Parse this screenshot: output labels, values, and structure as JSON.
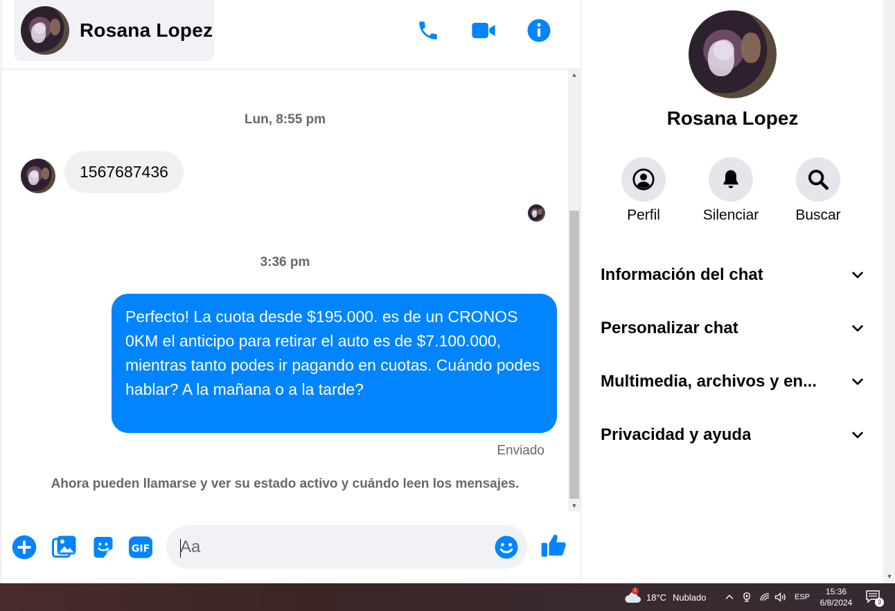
{
  "colors": {
    "accent": "#0084ff",
    "bubble_in": "#f0f0f0",
    "muted_text": "#65676b"
  },
  "header": {
    "contact_name": "Rosana Lopez",
    "actions": [
      {
        "icon": "phone-icon"
      },
      {
        "icon": "video-camera-icon"
      },
      {
        "icon": "info-icon"
      }
    ]
  },
  "messages": {
    "timestamp_1": "Lun, 8:55 pm",
    "received_text": "1567687436",
    "timestamp_2": "3:36 pm",
    "sent_text": "Perfecto! La cuota desde $195.000. es de un CRONOS 0KM el anticipo para retirar el auto es de $7.100.000, mientras tanto podes ir pagando en cuotas. Cuándo podes hablar? A la mañana o a la tarde?",
    "sent_status": "Enviado",
    "notice": "Ahora pueden llamarse y ver su estado activo y cuándo leen los mensajes."
  },
  "composer": {
    "placeholder": "Aa",
    "value": "",
    "icons": [
      "plus-icon",
      "image-icon",
      "sticker-icon",
      "gif-icon",
      "emoji-icon",
      "thumbs-up-icon"
    ],
    "gif_label": "GIF"
  },
  "info_panel": {
    "name": "Rosana Lopez",
    "actions": [
      {
        "label": "Perfil",
        "icon": "profile-icon"
      },
      {
        "label": "Silenciar",
        "icon": "bell-icon"
      },
      {
        "label": "Buscar",
        "icon": "search-icon"
      }
    ],
    "sections": [
      {
        "title": "Información del chat"
      },
      {
        "title": "Personalizar chat"
      },
      {
        "title": "Multimedia, archivos y en..."
      },
      {
        "title": "Privacidad y ayuda"
      }
    ]
  },
  "taskbar": {
    "weather_temp": "18°C",
    "weather_desc": "Nublado",
    "weather_badge": "1",
    "language": "ESP",
    "time": "15:36",
    "date": "6/8/2024",
    "notifications_count": "3"
  }
}
